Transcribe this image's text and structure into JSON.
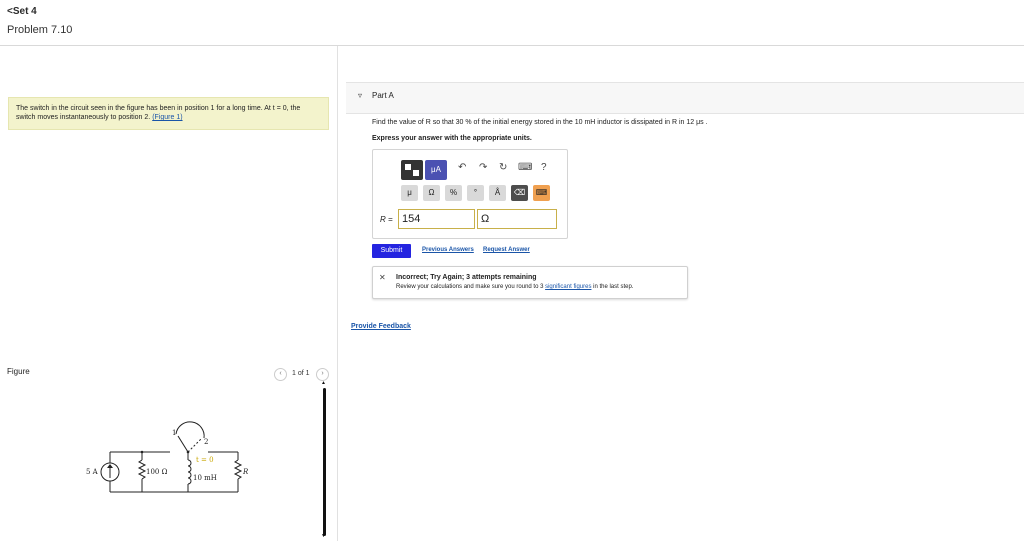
{
  "nav": {
    "back_label": "<Set 4",
    "problem_title": "Problem 7.10"
  },
  "statement": {
    "text": "The switch in the circuit seen in the figure has been in position 1 for a long time. At t = 0, the switch moves instantaneously to position 2.",
    "figure_link": "(Figure 1)"
  },
  "part": {
    "toggle_icon": "▿",
    "label": "Part A",
    "question": "Find the value of R so that 30 % of the initial energy stored in the 10 mH inductor is dissipated in R in 12 μs .",
    "instruction": "Express your answer with the appropriate units."
  },
  "toolbar": {
    "ua_label": "μA",
    "undo_icon": "↶",
    "redo_icon": "↷",
    "reset_icon": "↻",
    "keyboard_icon": "⌨",
    "help_icon": "?"
  },
  "symbols": [
    "μ",
    "Ω",
    "%",
    "°",
    "Å",
    "⌫",
    "⌨"
  ],
  "answer": {
    "variable_label": "R =",
    "value": "154",
    "unit": "Ω"
  },
  "actions": {
    "submit": "Submit",
    "previous_answers": "Previous Answers",
    "request_answer": "Request Answer"
  },
  "feedback": {
    "icon": "✕",
    "title": "Incorrect; Try Again; 3 attempts remaining",
    "message_prefix": "Review your calculations and make sure you round to 3 ",
    "message_link": "significant figures",
    "message_suffix": " in the last step."
  },
  "provide_feedback": "Provide Feedback",
  "figure": {
    "label": "Figure",
    "pager": "1 of 1",
    "prev_icon": "‹",
    "next_icon": "›",
    "circuit_labels": {
      "source": "5 A",
      "r1": "100 Ω",
      "inductor": "10 mH",
      "r_load": "R",
      "pos1": "1",
      "pos2": "2",
      "time": "t = 0"
    }
  },
  "colors": {
    "submit": "#2424e0",
    "statement_bg": "#f3f3cc",
    "link": "#1a55a8",
    "ua_button": "#4b51b2"
  }
}
